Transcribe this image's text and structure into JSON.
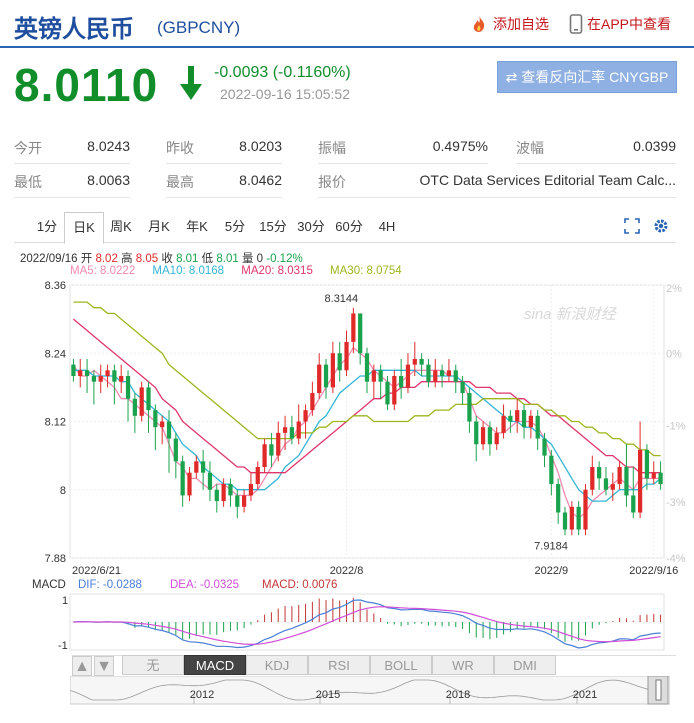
{
  "header": {
    "title": "英镑人民币",
    "code": "(GBPCNY)",
    "add_label": "添加自选",
    "app_label": "在APP中查看"
  },
  "quote": {
    "price": "8.0110",
    "change": "-0.0093 (-0.1160%)",
    "time": "2022-09-16 15:05:52",
    "reverse_label": "⇄ 查看反向汇率 CNYGBP"
  },
  "stats": [
    [
      {
        "label": "今开",
        "value": "8.0243"
      },
      {
        "label": "昨收",
        "value": "8.0203"
      },
      {
        "label": "振幅",
        "value": "0.4975%"
      },
      {
        "label": "波幅",
        "value": "0.0399"
      }
    ],
    [
      {
        "label": "最低",
        "value": "8.0063"
      },
      {
        "label": "最高",
        "value": "8.0462"
      },
      {
        "label": "报价",
        "value": "OTC Data Services Editorial Team Calc..."
      }
    ]
  ],
  "tabs": [
    "1分",
    "日K",
    "周K",
    "月K",
    "年K",
    "5分",
    "15分",
    "30分",
    "60分",
    "4H"
  ],
  "active_tab": 1,
  "bar_info": {
    "date": "2022/09/16",
    "open_label": "开",
    "open": "8.02",
    "high_label": "高",
    "high": "8.05",
    "close_label": "收",
    "close": "8.01",
    "low_label": "低",
    "low": "8.01",
    "vol_label": "量",
    "vol": "0",
    "pct": "-0.12%"
  },
  "ma_legend": [
    {
      "label": "MA5: 8.0222",
      "color": "#f08ab0"
    },
    {
      "label": "MA10: 8.0168",
      "color": "#33b5d6"
    },
    {
      "label": "MA20: 8.0315",
      "color": "#e0356a"
    },
    {
      "label": "MA30: 8.0754",
      "color": "#9db51e"
    }
  ],
  "macd_legend": {
    "title": "MACD",
    "dif": "DIF: -0.0288",
    "dea": "DEA: -0.0325",
    "macd": "MACD: 0.0076"
  },
  "bottom_tabs": [
    "无",
    "MACD",
    "KDJ",
    "RSI",
    "BOLL",
    "WR",
    "DMI"
  ],
  "bottom_active": 1,
  "watermark": "sina 新浪财经",
  "colors": {
    "up": "#e02a2a",
    "down": "#1aa24d",
    "brand": "#1f4e9e"
  },
  "chart_data": {
    "type": "candlestick",
    "y_ticks": [
      "8.36",
      "8.24",
      "8.12",
      "8",
      "7.88"
    ],
    "y_range": [
      7.88,
      8.36
    ],
    "right_ticks": [
      "2%",
      "0%",
      "-1%",
      "-3%",
      "-4%"
    ],
    "x_labels": [
      "2022/6/21",
      "2022/8",
      "2022/9",
      "2022/9/16"
    ],
    "annotations": [
      {
        "text": "8.3144"
      },
      {
        "text": "7.9184"
      }
    ],
    "macd_ticks": [
      "1",
      "-1"
    ],
    "navigator_years": [
      "2012",
      "2015",
      "2018",
      "2021"
    ],
    "candles": [
      [
        8.22,
        8.2,
        8.23,
        8.19
      ],
      [
        8.2,
        8.21,
        8.23,
        8.18
      ],
      [
        8.21,
        8.2,
        8.23,
        8.17
      ],
      [
        8.2,
        8.19,
        8.21,
        8.15
      ],
      [
        8.19,
        8.2,
        8.22,
        8.17
      ],
      [
        8.2,
        8.21,
        8.22,
        8.18
      ],
      [
        8.21,
        8.19,
        8.22,
        8.15
      ],
      [
        8.19,
        8.2,
        8.22,
        8.17
      ],
      [
        8.2,
        8.16,
        8.21,
        8.12
      ],
      [
        8.16,
        8.13,
        8.17,
        8.1
      ],
      [
        8.13,
        8.18,
        8.19,
        8.12
      ],
      [
        8.18,
        8.14,
        8.19,
        8.1
      ],
      [
        8.14,
        8.11,
        8.15,
        8.07
      ],
      [
        8.11,
        8.12,
        8.13,
        8.08
      ],
      [
        8.12,
        8.09,
        8.14,
        8.03
      ],
      [
        8.09,
        8.05,
        8.1,
        8.02
      ],
      [
        8.05,
        7.99,
        8.06,
        7.97
      ],
      [
        7.99,
        8.03,
        8.04,
        7.98
      ],
      [
        8.03,
        8.05,
        8.06,
        8.02
      ],
      [
        8.05,
        8.03,
        8.07,
        8.0
      ],
      [
        8.03,
        8.0,
        8.05,
        7.98
      ],
      [
        8.0,
        7.98,
        8.01,
        7.96
      ],
      [
        7.98,
        8.01,
        8.02,
        7.97
      ],
      [
        8.01,
        7.99,
        8.02,
        7.97
      ],
      [
        7.99,
        7.97,
        8.0,
        7.95
      ],
      [
        7.97,
        7.99,
        8.0,
        7.96
      ],
      [
        7.99,
        8.01,
        8.03,
        7.98
      ],
      [
        8.01,
        8.04,
        8.05,
        8.0
      ],
      [
        8.04,
        8.08,
        8.09,
        8.03
      ],
      [
        8.08,
        8.06,
        8.1,
        8.04
      ],
      [
        8.06,
        8.1,
        8.12,
        8.05
      ],
      [
        8.1,
        8.11,
        8.13,
        8.07
      ],
      [
        8.11,
        8.09,
        8.13,
        8.08
      ],
      [
        8.09,
        8.12,
        8.15,
        8.08
      ],
      [
        8.12,
        8.14,
        8.15,
        8.09
      ],
      [
        8.14,
        8.17,
        8.19,
        8.13
      ],
      [
        8.17,
        8.22,
        8.24,
        8.16
      ],
      [
        8.22,
        8.18,
        8.23,
        8.16
      ],
      [
        8.18,
        8.24,
        8.26,
        8.17
      ],
      [
        8.24,
        8.21,
        8.26,
        8.19
      ],
      [
        8.21,
        8.26,
        8.28,
        8.2
      ],
      [
        8.26,
        8.31,
        8.32,
        8.24
      ],
      [
        8.31,
        8.24,
        8.31,
        8.22
      ],
      [
        8.24,
        8.19,
        8.25,
        8.17
      ],
      [
        8.19,
        8.21,
        8.22,
        8.16
      ],
      [
        8.21,
        8.19,
        8.22,
        8.16
      ],
      [
        8.19,
        8.15,
        8.2,
        8.14
      ],
      [
        8.15,
        8.2,
        8.21,
        8.14
      ],
      [
        8.2,
        8.18,
        8.23,
        8.16
      ],
      [
        8.18,
        8.22,
        8.24,
        8.17
      ],
      [
        8.22,
        8.23,
        8.26,
        8.2
      ],
      [
        8.23,
        8.22,
        8.24,
        8.2
      ],
      [
        8.22,
        8.19,
        8.23,
        8.18
      ],
      [
        8.19,
        8.21,
        8.23,
        8.18
      ],
      [
        8.21,
        8.2,
        8.22,
        8.18
      ],
      [
        8.2,
        8.21,
        8.23,
        8.19
      ],
      [
        8.21,
        8.19,
        8.22,
        8.17
      ],
      [
        8.19,
        8.17,
        8.2,
        8.15
      ],
      [
        8.17,
        8.12,
        8.18,
        8.1
      ],
      [
        8.12,
        8.08,
        8.13,
        8.05
      ],
      [
        8.08,
        8.11,
        8.12,
        8.07
      ],
      [
        8.11,
        8.08,
        8.12,
        8.06
      ],
      [
        8.08,
        8.1,
        8.11,
        8.07
      ],
      [
        8.1,
        8.13,
        8.15,
        8.09
      ],
      [
        8.13,
        8.12,
        8.14,
        8.1
      ],
      [
        8.12,
        8.14,
        8.16,
        8.1
      ],
      [
        8.14,
        8.11,
        8.15,
        8.09
      ],
      [
        8.11,
        8.13,
        8.14,
        8.09
      ],
      [
        8.13,
        8.09,
        8.14,
        8.07
      ],
      [
        8.09,
        8.06,
        8.1,
        8.04
      ],
      [
        8.06,
        8.01,
        8.07,
        7.99
      ],
      [
        8.01,
        7.96,
        8.02,
        7.94
      ],
      [
        7.96,
        7.93,
        7.97,
        7.92
      ],
      [
        7.93,
        7.97,
        7.98,
        7.92
      ],
      [
        7.97,
        7.93,
        7.98,
        7.92
      ],
      [
        7.93,
        8.0,
        8.01,
        7.92
      ],
      [
        8.0,
        8.04,
        8.06,
        7.99
      ],
      [
        8.04,
        8.02,
        8.05,
        8.0
      ],
      [
        8.02,
        8.0,
        8.04,
        7.99
      ],
      [
        8.0,
        8.01,
        8.03,
        7.98
      ],
      [
        8.01,
        8.04,
        8.05,
        8.0
      ],
      [
        8.04,
        7.99,
        8.08,
        7.97
      ],
      [
        7.99,
        7.96,
        8.04,
        7.95
      ],
      [
        7.96,
        8.07,
        8.12,
        7.95
      ],
      [
        8.07,
        8.02,
        8.08,
        8.0
      ],
      [
        8.02,
        8.03,
        8.05,
        8.01
      ],
      [
        8.03,
        8.01,
        8.05,
        8.0
      ]
    ],
    "ma_series": [
      {
        "name": "MA5",
        "color": "#f08ab0",
        "values": [
          8.22,
          8.2,
          8.2,
          8.21,
          8.2,
          8.19,
          8.18,
          8.16,
          8.16,
          8.15,
          8.14,
          8.13,
          8.12,
          8.11,
          8.08,
          8.05,
          8.04,
          8.02,
          8.02,
          8.01,
          8.0,
          8.01,
          8.01,
          8.0,
          7.99,
          7.99,
          7.99,
          8.0,
          8.02,
          8.04,
          8.06,
          8.08,
          8.09,
          8.11,
          8.12,
          8.14,
          8.16,
          8.18,
          8.2,
          8.22,
          8.23,
          8.25,
          8.24,
          8.23,
          8.21,
          8.2,
          8.19,
          8.18,
          8.19,
          8.2,
          8.21,
          8.21,
          8.21,
          8.21,
          8.21,
          8.2,
          8.2,
          8.19,
          8.16,
          8.13,
          8.12,
          8.11,
          8.1,
          8.1,
          8.11,
          8.12,
          8.12,
          8.12,
          8.11,
          8.09,
          8.06,
          8.03,
          7.99,
          7.96,
          7.95,
          7.96,
          7.98,
          7.99,
          8.0,
          8.01,
          8.02,
          8.01,
          8.0,
          8.02,
          8.02,
          8.02,
          8.02
        ]
      },
      {
        "name": "MA10",
        "color": "#33b5d6",
        "values": [
          8.21,
          8.21,
          8.21,
          8.2,
          8.2,
          8.2,
          8.2,
          8.19,
          8.19,
          8.17,
          8.16,
          8.15,
          8.14,
          8.13,
          8.12,
          8.1,
          8.08,
          8.07,
          8.06,
          8.04,
          8.03,
          8.02,
          8.01,
          8.01,
          8.0,
          8.0,
          8.0,
          8.0,
          8.0,
          8.01,
          8.02,
          8.04,
          8.05,
          8.06,
          8.08,
          8.1,
          8.12,
          8.13,
          8.15,
          8.17,
          8.18,
          8.19,
          8.2,
          8.2,
          8.21,
          8.21,
          8.21,
          8.21,
          8.21,
          8.21,
          8.21,
          8.2,
          8.2,
          8.2,
          8.2,
          8.2,
          8.2,
          8.19,
          8.18,
          8.17,
          8.16,
          8.15,
          8.14,
          8.13,
          8.12,
          8.12,
          8.11,
          8.11,
          8.1,
          8.09,
          8.08,
          8.06,
          8.04,
          8.02,
          8.0,
          7.99,
          7.98,
          7.98,
          7.98,
          7.99,
          8.0,
          8.0,
          8.0,
          8.0,
          8.01,
          8.01,
          8.02
        ]
      },
      {
        "name": "MA20",
        "color": "#e0356a",
        "values": [
          8.3,
          8.29,
          8.28,
          8.27,
          8.26,
          8.25,
          8.24,
          8.23,
          8.22,
          8.21,
          8.2,
          8.19,
          8.18,
          8.16,
          8.15,
          8.14,
          8.12,
          8.11,
          8.1,
          8.09,
          8.08,
          8.07,
          8.06,
          8.05,
          8.04,
          8.04,
          8.03,
          8.03,
          8.03,
          8.03,
          8.03,
          8.03,
          8.04,
          8.05,
          8.06,
          8.07,
          8.08,
          8.09,
          8.1,
          8.11,
          8.12,
          8.13,
          8.14,
          8.15,
          8.16,
          8.16,
          8.17,
          8.17,
          8.18,
          8.18,
          8.18,
          8.19,
          8.19,
          8.19,
          8.19,
          8.19,
          8.19,
          8.19,
          8.19,
          8.18,
          8.18,
          8.18,
          8.17,
          8.17,
          8.17,
          8.16,
          8.16,
          8.15,
          8.15,
          8.14,
          8.13,
          8.13,
          8.12,
          8.11,
          8.1,
          8.09,
          8.08,
          8.07,
          8.06,
          8.06,
          8.05,
          8.04,
          8.04,
          8.03,
          8.03,
          8.03,
          8.03
        ]
      },
      {
        "name": "MA30",
        "color": "#9db51e",
        "values": [
          8.33,
          8.33,
          8.33,
          8.32,
          8.32,
          8.31,
          8.31,
          8.3,
          8.29,
          8.28,
          8.27,
          8.26,
          8.25,
          8.24,
          8.22,
          8.21,
          8.2,
          8.19,
          8.18,
          8.17,
          8.16,
          8.15,
          8.14,
          8.13,
          8.12,
          8.11,
          8.1,
          8.09,
          8.09,
          8.09,
          8.09,
          8.09,
          8.09,
          8.1,
          8.1,
          8.1,
          8.11,
          8.11,
          8.12,
          8.12,
          8.12,
          8.13,
          8.13,
          8.13,
          8.12,
          8.12,
          8.12,
          8.12,
          8.12,
          8.12,
          8.13,
          8.13,
          8.13,
          8.14,
          8.14,
          8.14,
          8.15,
          8.15,
          8.15,
          8.15,
          8.16,
          8.16,
          8.16,
          8.16,
          8.16,
          8.16,
          8.15,
          8.15,
          8.15,
          8.14,
          8.14,
          8.13,
          8.13,
          8.12,
          8.12,
          8.11,
          8.11,
          8.1,
          8.1,
          8.09,
          8.09,
          8.08,
          8.08,
          8.07,
          8.07,
          8.06,
          8.06
        ]
      }
    ]
  }
}
